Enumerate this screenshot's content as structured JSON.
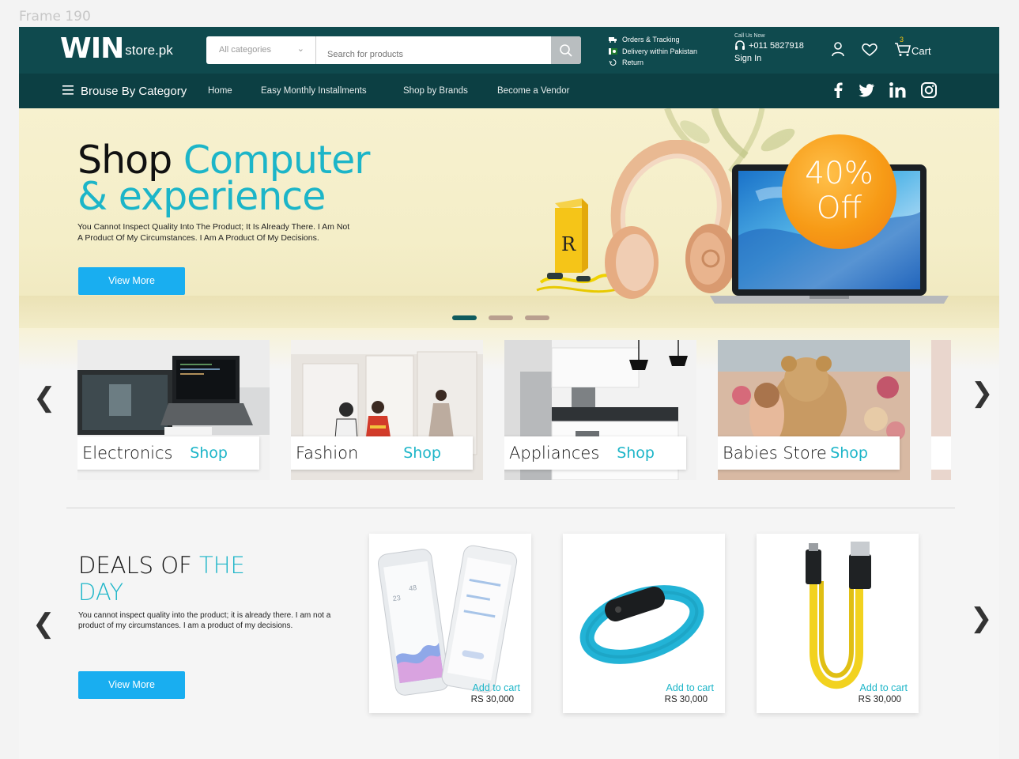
{
  "frame_label": "Frame 190",
  "header": {
    "logo_main": "WIN",
    "logo_suffix": "store.pk",
    "search": {
      "category_label": "All categories",
      "placeholder": "Search for products"
    },
    "info": [
      "Orders & Tracking",
      "Delivery within Pakistan",
      "Return"
    ],
    "call_label": "Call Us Now",
    "phone": "+011 5827918",
    "signin": "Sign In",
    "cart_label": "Cart",
    "cart_count": "3"
  },
  "nav": {
    "browse_label": "Brouse By Category",
    "links": [
      "Home",
      "Easy Monthly Installments",
      "Shop by Brands",
      "Become a Vendor"
    ]
  },
  "hero": {
    "title_dark": "Shop ",
    "title_teal_1": "Computer",
    "title_teal_2": "& experience",
    "description": "You Cannot Inspect Quality Into The Product; It Is Already There. I Am Not A Product Of My Circumstances. I Am A Product Of My Decisions.",
    "button_label": "View More",
    "badge_line1": "40%",
    "badge_line2": "Off",
    "slides": 3,
    "active_slide": 1
  },
  "categories": [
    {
      "name": "Electronics",
      "action": "Shop"
    },
    {
      "name": "Fashion",
      "action": "Shop"
    },
    {
      "name": "Appliances",
      "action": "Shop"
    },
    {
      "name": "Babies Store",
      "action": "Shop"
    }
  ],
  "deals": {
    "title_dark_1": "DEALS OF ",
    "title_teal_1": "THE",
    "title_teal_2": "DAY",
    "description": "You cannot inspect quality into the product; it is already there. I am not a product of my circumstances. I am a product of my decisions.",
    "button_label": "View More",
    "products": [
      {
        "action": "Add to cart",
        "price": "RS 30,000"
      },
      {
        "action": "Add to cart",
        "price": "RS 30,000"
      },
      {
        "action": "Add to cart",
        "price": "RS 30,000"
      }
    ]
  },
  "colors": {
    "header_bg": "#0f4a4e",
    "accent_teal": "#1cb5c8",
    "button_blue": "#19aef0",
    "badge_orange": "#f79b16"
  }
}
